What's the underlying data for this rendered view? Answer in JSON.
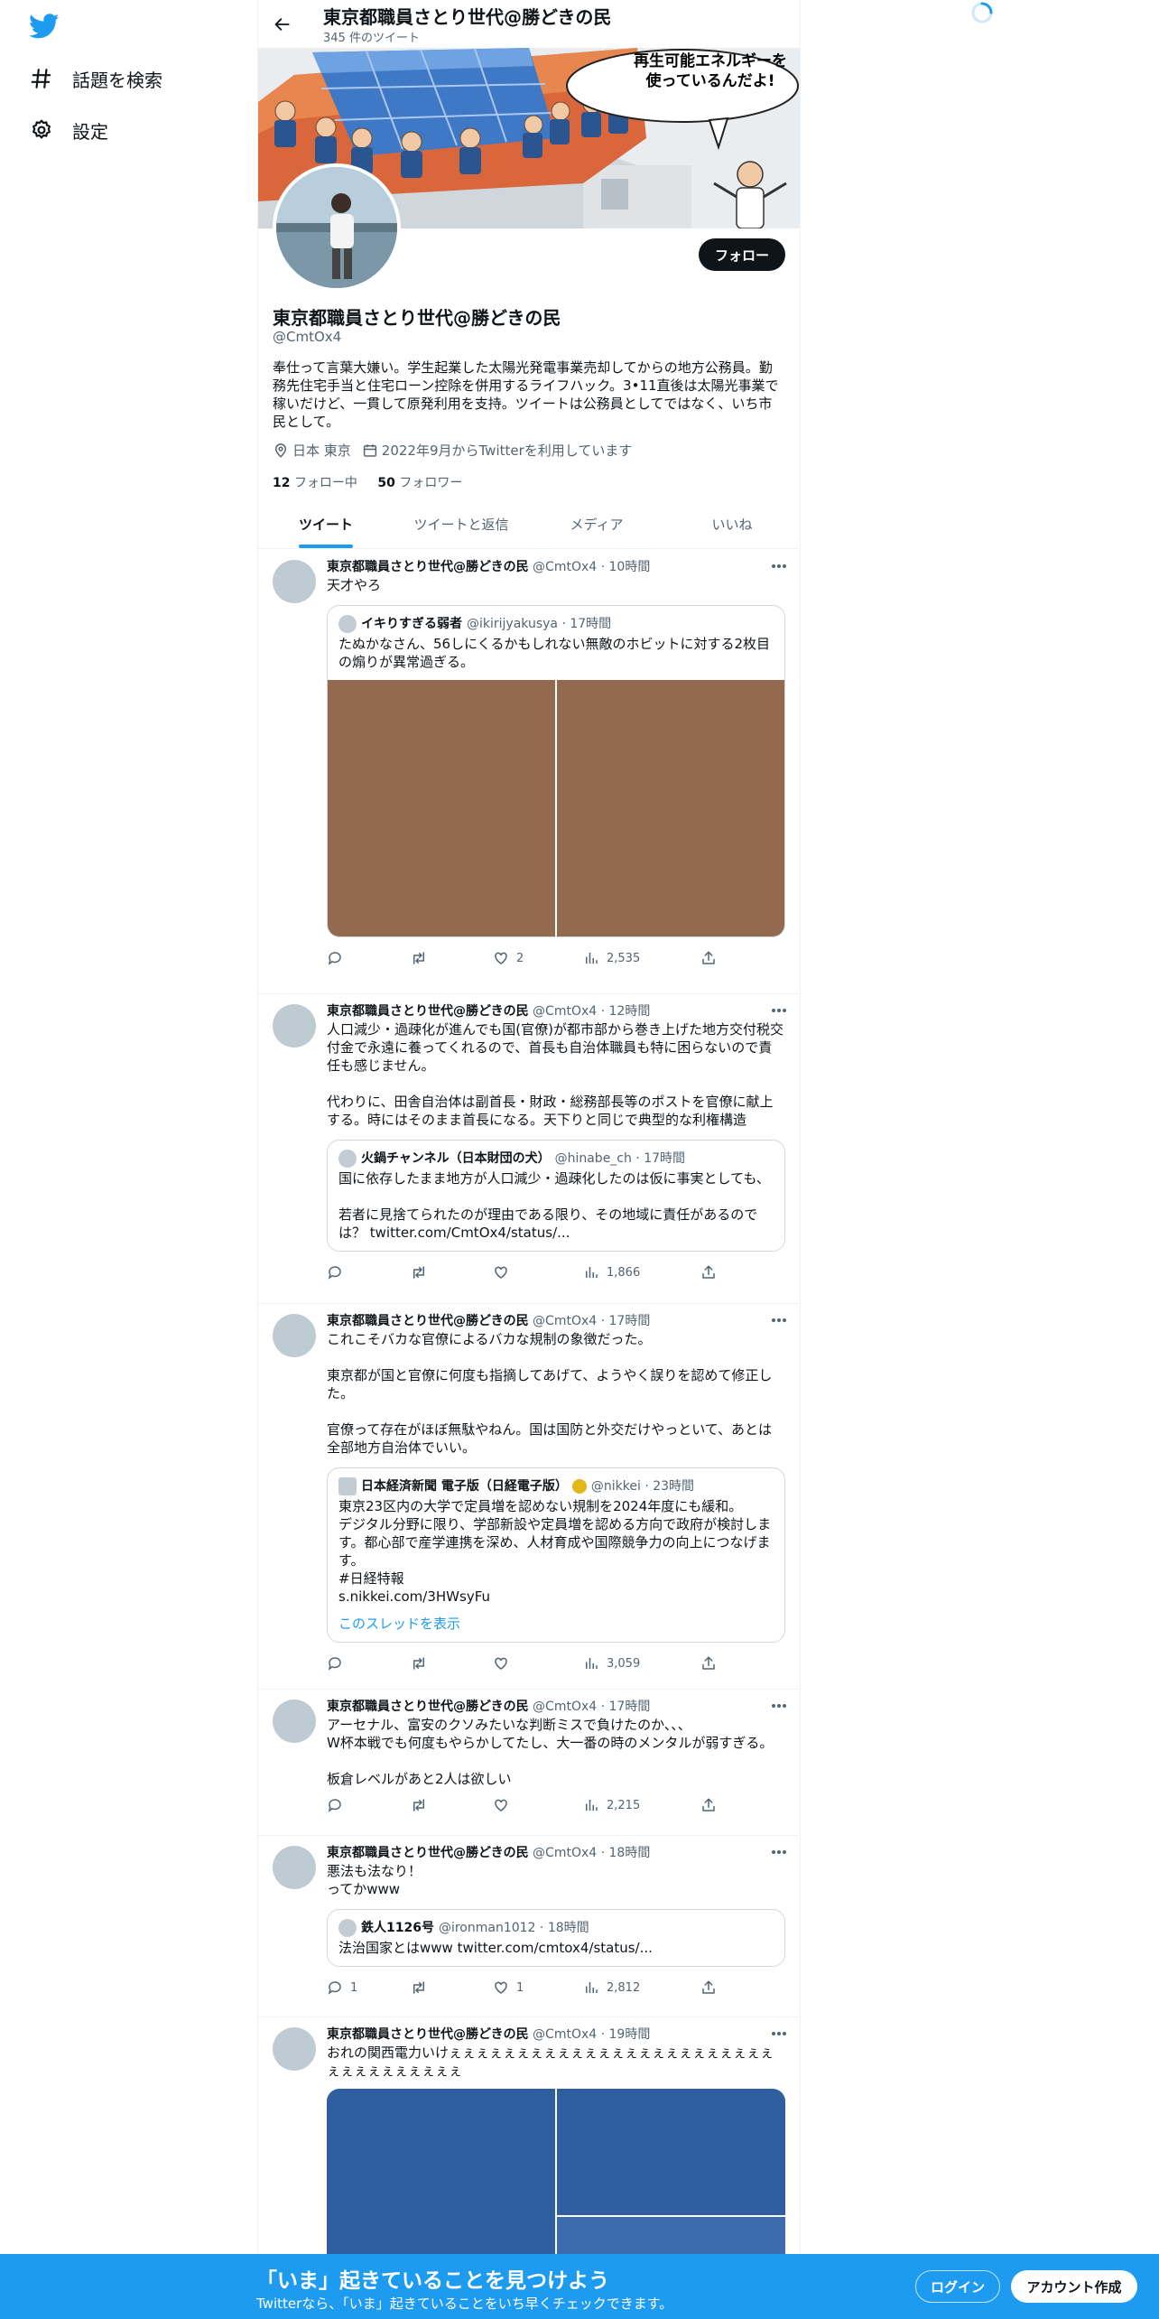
{
  "nav": {
    "explore_label": "話題を検索",
    "settings_label": "設定"
  },
  "profile": {
    "header_title": "東京都職員さとり世代@勝どきの民",
    "tweet_count": "345 件のツイート",
    "banner_caption_line1": "再生可能エネルギーを",
    "banner_caption_line2": "使っているんだよ!",
    "follow_label": "フォロー",
    "name": "東京都職員さとり世代@勝どきの民",
    "handle": "@CmtOx4",
    "bio": "奉仕って言葉大嫌い。学生起業した太陽光発電事業売却してからの地方公務員。勤務先住宅手当と住宅ローン控除を併用するライフハック。3•11直後は太陽光事業で稼いだけど、一貫して原発利用を支持。ツイートは公務員としてではなく、いち市民として。",
    "location": "日本 東京",
    "joined": "2022年9月からTwitterを利用しています",
    "following_count": "12",
    "following_label": "フォロー中",
    "followers_count": "50",
    "followers_label": "フォロワー"
  },
  "tabs": [
    "ツイート",
    "ツイートと返信",
    "メディア",
    "いいね"
  ],
  "tweets": [
    {
      "name": "東京都職員さとり世代@勝どきの民",
      "handle": "@CmtOx4",
      "time": "· 10時間",
      "text": "天才やろ",
      "quote": {
        "name": "イキりすぎる弱者",
        "handle": "@ikirijyakusya",
        "time": "· 17時間",
        "text": "たぬかなさん、56しにくるかもしれない無敵のホビットに対する2枚目の煽りが異常過ぎる。"
      },
      "replies": "",
      "retweets": "",
      "likes": "2",
      "views": "2,535"
    },
    {
      "name": "東京都職員さとり世代@勝どきの民",
      "handle": "@CmtOx4",
      "time": "· 12時間",
      "text": "人口減少・過疎化が進んでも国(官僚)が都市部から巻き上げた地方交付税交付金で永遠に養ってくれるので、首長も自治体職員も特に困らないので責任も感じません。\n\n代わりに、田舎自治体は副首長・財政・総務部長等のポストを官僚に献上する。時にはそのまま首長になる。天下りと同じで典型的な利権構造",
      "quote": {
        "name": "火鍋チャンネル（日本財団の犬）",
        "handle": "@hinabe_ch",
        "time": "· 17時間",
        "text": "国に依存したまま地方が人口減少・過疎化したのは仮に事実としても、\n\n若者に見捨てられたのが理由である限り、その地域に責任があるのでは？ twitter.com/CmtOx4/status/..."
      },
      "replies": "",
      "retweets": "",
      "likes": "",
      "views": "1,866"
    },
    {
      "name": "東京都職員さとり世代@勝どきの民",
      "handle": "@CmtOx4",
      "time": "· 17時間",
      "text": "これこそバカな官僚によるバカな規制の象徴だった。\n\n東京都が国と官僚に何度も指摘してあげて、ようやく誤りを認めて修正した。\n\n官僚って存在がほぼ無駄やねん。国は国防と外交だけやっといて、あとは全部地方自治体でいい。",
      "quote": {
        "name": "日本経済新聞 電子版（日経電子版）",
        "handle": "@nikkei",
        "time": "· 23時間",
        "text": "東京23区内の大学で定員増を認めない規制を2024年度にも緩和。\nデジタル分野に限り、学部新設や定員増を認める方向で政府が検討します。都心部で産学連携を深め、人材育成や国際競争力の向上につなげます。\n#日経特報\ns.nikkei.com/3HWsyFu",
        "thread_link": "このスレッドを表示"
      },
      "replies": "",
      "retweets": "",
      "likes": "",
      "views": "3,059"
    },
    {
      "name": "東京都職員さとり世代@勝どきの民",
      "handle": "@CmtOx4",
      "time": "· 17時間",
      "text": "アーセナル、富安のクソみたいな判断ミスで負けたのか、、、\nW杯本戦でも何度もやらかしてたし、大一番の時のメンタルが弱すぎる。\n\n板倉レベルがあと2人は欲しい",
      "replies": "",
      "retweets": "",
      "likes": "",
      "views": "2,215"
    },
    {
      "name": "東京都職員さとり世代@勝どきの民",
      "handle": "@CmtOx4",
      "time": "· 18時間",
      "text": "悪法も法なり！\nってかwww",
      "quote": {
        "name": "鉄人1126号",
        "handle": "@ironman1012",
        "time": "· 18時間",
        "text": "法治国家とはwww twitter.com/cmtox4/status/..."
      },
      "replies": "1",
      "retweets": "",
      "likes": "1",
      "views": "2,812"
    },
    {
      "name": "東京都職員さとり世代@勝どきの民",
      "handle": "@CmtOx4",
      "time": "· 19時間",
      "text": "おれの関西電力いけぇぇぇぇぇぇぇぇぇぇぇぇぇぇぇぇぇぇぇぇぇぇぇぇぇぇぇぇぇぇぇぇぇぇ"
    }
  ],
  "bottom_bar": {
    "title": "「いま」起きていることを見つけよう",
    "subtitle": "Twitterなら、「いま」起きていることをいち早くチェックできます。",
    "login_label": "ログイン",
    "signup_label": "アカウント作成"
  },
  "colors": {
    "accent": "#1d9bf0",
    "text_primary": "#0f1419",
    "text_secondary": "#536471",
    "media_brown": "#946a4e",
    "media_blue": "#2f5f9f"
  }
}
